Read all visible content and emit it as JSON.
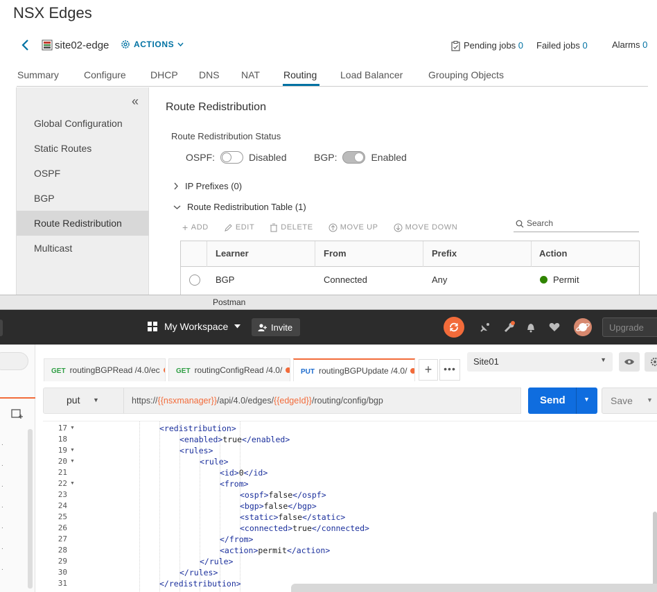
{
  "nsx": {
    "title": "NSX Edges",
    "edge_name": "site02-edge",
    "actions_label": "ACTIONS",
    "pending_jobs_label": "Pending jobs",
    "pending_jobs_count": "0",
    "failed_jobs_label": "Failed jobs",
    "failed_jobs_count": "0",
    "alarms_label": "Alarms",
    "alarms_count": "0",
    "tabs": [
      "Summary",
      "Configure",
      "DHCP",
      "DNS",
      "NAT",
      "Routing",
      "Load Balancer",
      "Grouping Objects"
    ],
    "active_tab": "Routing",
    "sidebar": [
      "Global Configuration",
      "Static Routes",
      "OSPF",
      "BGP",
      "Route Redistribution",
      "Multicast"
    ],
    "active_sidebar": "Route Redistribution",
    "panel_title": "Route Redistribution",
    "status_title": "Route Redistribution Status",
    "ospf_label": "OSPF:",
    "ospf_state": "Disabled",
    "bgp_label": "BGP:",
    "bgp_state": "Enabled",
    "ip_prefixes": "IP Prefixes (0)",
    "table_section": "Route Redistribution Table (1)",
    "toolbar": [
      "ADD",
      "EDIT",
      "DELETE",
      "MOVE UP",
      "MOVE DOWN"
    ],
    "search_placeholder": "Search",
    "columns": [
      "Learner",
      "From",
      "Prefix",
      "Action"
    ],
    "row": {
      "learner": "BGP",
      "from": "Connected",
      "prefix": "Any",
      "action": "Permit"
    },
    "colors": {
      "accent": "#0072a3",
      "permit": "#2f8400"
    }
  },
  "postman": {
    "window_title": "Postman",
    "workspace": "My Workspace",
    "invite": "Invite",
    "upgrade": "Upgrade",
    "tabs": [
      {
        "method": "GET",
        "name": "routingBGPRead /4.0/ec"
      },
      {
        "method": "GET",
        "name": "routingConfigRead /4.0/"
      },
      {
        "method": "PUT",
        "name": "routingBGPUpdate /4.0/"
      }
    ],
    "environment": "Site01",
    "method": "put",
    "url_prefix": "https://",
    "url_var1": "{{nsxmanager}}",
    "url_mid": "/api/4.0/edges/",
    "url_var2": "{{edgeId}}",
    "url_suffix": "/routing/config/bgp",
    "send": "Send",
    "save": "Save",
    "code_lines": [
      {
        "n": "17",
        "indent": 1,
        "fold": true,
        "parts": [
          [
            "tg",
            "<redistribution>"
          ]
        ]
      },
      {
        "n": "18",
        "indent": 2,
        "fold": false,
        "parts": [
          [
            "tg",
            "<enabled>"
          ],
          [
            "t",
            "true"
          ],
          [
            "tg",
            "</enabled>"
          ]
        ]
      },
      {
        "n": "19",
        "indent": 2,
        "fold": true,
        "parts": [
          [
            "tg",
            "<rules>"
          ]
        ]
      },
      {
        "n": "20",
        "indent": 3,
        "fold": true,
        "parts": [
          [
            "tg",
            "<rule>"
          ]
        ]
      },
      {
        "n": "21",
        "indent": 4,
        "fold": false,
        "parts": [
          [
            "tg",
            "<id>"
          ],
          [
            "t",
            "0"
          ],
          [
            "tg",
            "</id>"
          ]
        ]
      },
      {
        "n": "22",
        "indent": 4,
        "fold": true,
        "parts": [
          [
            "tg",
            "<from>"
          ]
        ]
      },
      {
        "n": "23",
        "indent": 5,
        "fold": false,
        "parts": [
          [
            "tg",
            "<ospf>"
          ],
          [
            "t",
            "false"
          ],
          [
            "tg",
            "</ospf>"
          ]
        ]
      },
      {
        "n": "24",
        "indent": 5,
        "fold": false,
        "parts": [
          [
            "tg",
            "<bgp>"
          ],
          [
            "t",
            "false"
          ],
          [
            "tg",
            "</bgp>"
          ]
        ]
      },
      {
        "n": "25",
        "indent": 5,
        "fold": false,
        "parts": [
          [
            "tg",
            "<static>"
          ],
          [
            "t",
            "false"
          ],
          [
            "tg",
            "</static>"
          ]
        ]
      },
      {
        "n": "26",
        "indent": 5,
        "fold": false,
        "parts": [
          [
            "tg",
            "<connected>"
          ],
          [
            "t",
            "true"
          ],
          [
            "tg",
            "</connected>"
          ]
        ]
      },
      {
        "n": "27",
        "indent": 4,
        "fold": false,
        "parts": [
          [
            "tg",
            "</from>"
          ]
        ]
      },
      {
        "n": "28",
        "indent": 4,
        "fold": false,
        "parts": [
          [
            "tg",
            "<action>"
          ],
          [
            "t",
            "permit"
          ],
          [
            "tg",
            "</action>"
          ]
        ]
      },
      {
        "n": "29",
        "indent": 3,
        "fold": false,
        "parts": [
          [
            "tg",
            "</rule>"
          ]
        ]
      },
      {
        "n": "30",
        "indent": 2,
        "fold": false,
        "parts": [
          [
            "tg",
            "</rules>"
          ]
        ]
      },
      {
        "n": "31",
        "indent": 1,
        "fold": false,
        "parts": [
          [
            "tg",
            "</redistribution>"
          ]
        ]
      }
    ],
    "colors": {
      "orange": "#f26b3a",
      "send": "#0f6ddf",
      "header": "#2c2c2c"
    }
  }
}
